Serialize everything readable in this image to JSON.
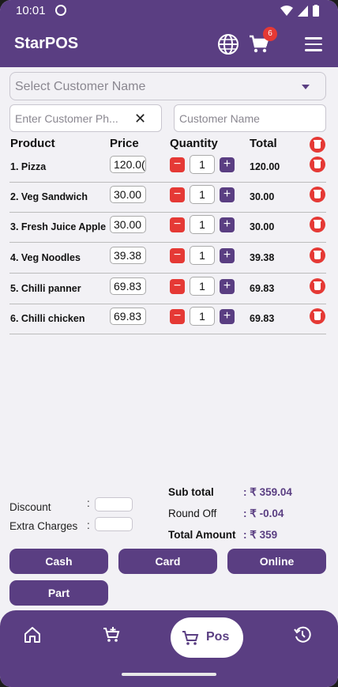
{
  "status_bar": {
    "time": "10:01"
  },
  "app_bar": {
    "title": "StarPOS",
    "cart_badge": "6",
    "icons": [
      "globe-icon",
      "cart-icon",
      "menu-icon"
    ]
  },
  "customer": {
    "select_placeholder": "Select Customer Name",
    "phone_placeholder": "Enter Customer Ph...",
    "name_placeholder": "Customer Name"
  },
  "table": {
    "headers": {
      "product": "Product",
      "price": "Price",
      "quantity": "Quantity",
      "total": "Total"
    },
    "rows": [
      {
        "name": "1. Pizza",
        "price": "120.0(",
        "qty": "1",
        "total": "120.00"
      },
      {
        "name": "2. Veg Sandwich",
        "price": "30.00",
        "qty": "1",
        "total": "30.00"
      },
      {
        "name": "3. Fresh Juice Apple",
        "price": "30.00",
        "qty": "1",
        "total": "30.00"
      },
      {
        "name": "4. Veg Noodles",
        "price": "39.38",
        "qty": "1",
        "total": "39.38"
      },
      {
        "name": "5. Chilli panner",
        "price": "69.83",
        "qty": "1",
        "total": "69.83"
      },
      {
        "name": "6. Chilli chicken",
        "price": "69.83",
        "qty": "1",
        "total": "69.83"
      }
    ]
  },
  "adjustments": {
    "discount_label": "Discount",
    "extra_label": "Extra Charges",
    "colon": ":"
  },
  "summary": {
    "subtotal_label": "Sub total",
    "subtotal_value": ": ₹ 359.04",
    "roundoff_label": "Round Off",
    "roundoff_value": ": ₹ -0.04",
    "total_label": "Total Amount",
    "total_value": ": ₹ 359"
  },
  "payment_buttons": {
    "cash": "Cash",
    "card": "Card",
    "online": "Online",
    "part": "Part"
  },
  "bottom_nav": {
    "pos_label": "Pos"
  },
  "colors": {
    "primary": "#5a3e82",
    "danger": "#e53935",
    "background": "#f2f1f5"
  }
}
